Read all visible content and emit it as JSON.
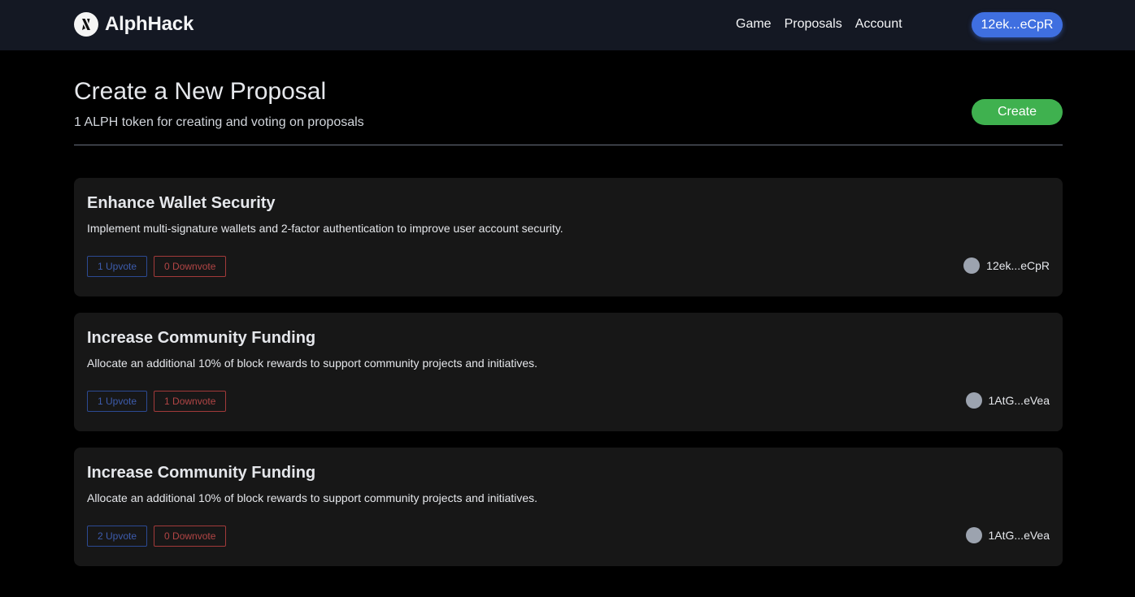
{
  "header": {
    "brand": "AlphHack",
    "nav": [
      "Game",
      "Proposals",
      "Account"
    ],
    "wallet_label": "12ek...eCpR"
  },
  "main": {
    "title": "Create a New Proposal",
    "subtitle": "1 ALPH token for creating and voting on proposals",
    "create_label": "Create"
  },
  "proposals": [
    {
      "title": "Enhance Wallet Security",
      "description": "Implement multi-signature wallets and 2-factor authentication to improve user account security.",
      "upvote": "1 Upvote",
      "downvote": "0 Downvote",
      "author": "12ek...eCpR"
    },
    {
      "title": "Increase Community Funding",
      "description": "Allocate an additional 10% of block rewards to support community projects and initiatives.",
      "upvote": "1 Upvote",
      "downvote": "1 Downvote",
      "author": "1AtG...eVea"
    },
    {
      "title": "Increase Community Funding",
      "description": "Allocate an additional 10% of block rewards to support community projects and initiatives.",
      "upvote": "2 Upvote",
      "downvote": "0 Downvote",
      "author": "1AtG...eVea"
    }
  ],
  "colors": {
    "navbar_bg": "#141823",
    "wallet_button": "#3f6fe0",
    "create_button": "#3fb14f",
    "card_bg": "#171717",
    "upvote": "#3d5cad",
    "downvote": "#b14545"
  },
  "icons": {
    "logo": "alphhack-logo-icon",
    "avatar": "avatar-icon"
  }
}
